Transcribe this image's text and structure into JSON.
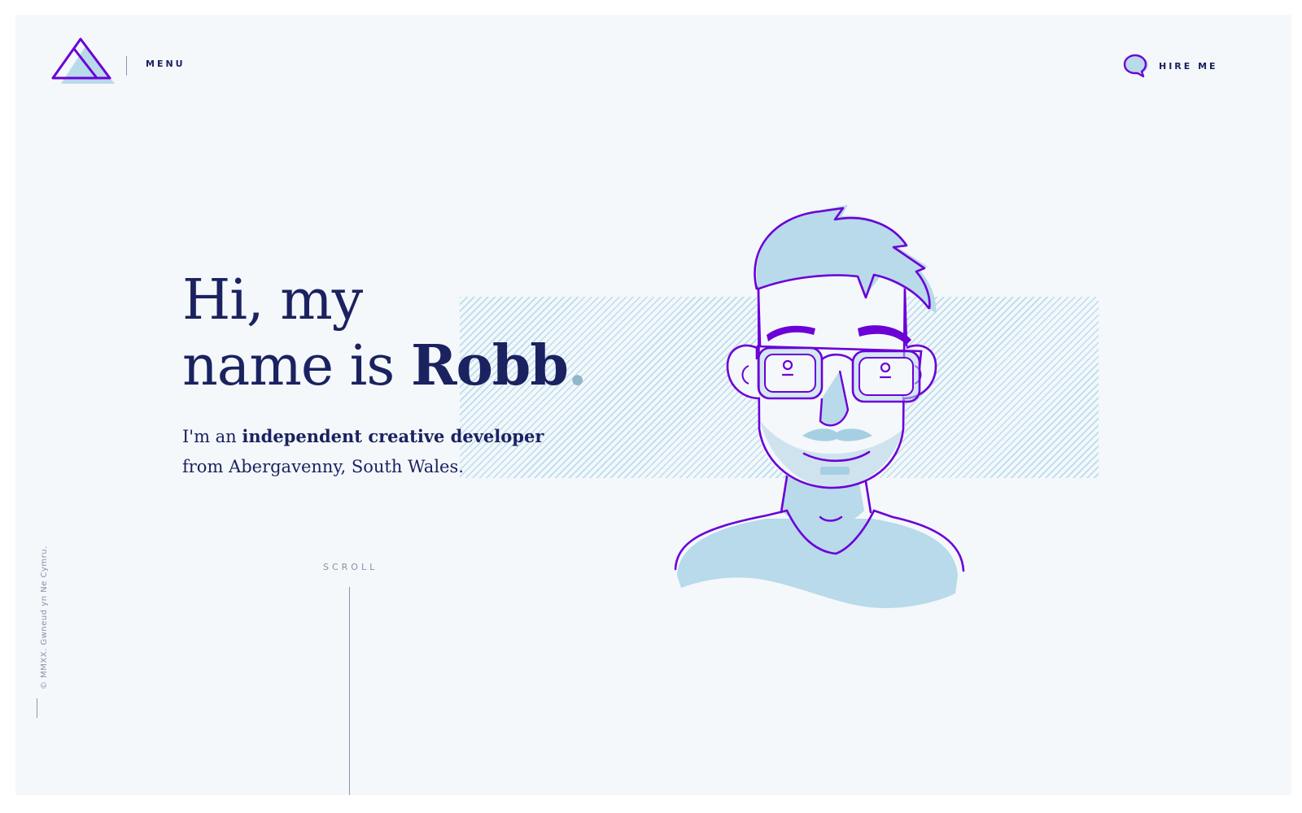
{
  "header": {
    "menu_label": "MENU",
    "hire_label": "HIRE ME"
  },
  "hero": {
    "headline_line1": "Hi, my",
    "headline_line2_prefix": "name is ",
    "headline_name": "Robb",
    "headline_dot": ".",
    "intro_prefix": "I'm an ",
    "intro_bold": "independent creative developer",
    "intro_line2": "from Abergavenny, South Wales."
  },
  "scroll": {
    "label": "SCROLL"
  },
  "footer": {
    "copyright": "© MMXX. Gwneud yn Ne Cymru."
  },
  "colors": {
    "navy": "#1b2260",
    "purple": "#6b00d7",
    "light_blue": "#b8daea",
    "background": "#f4f8fb"
  },
  "icons": {
    "logo": "triangle-logo-icon",
    "hire": "speech-bubble-icon",
    "portrait": "robb-portrait-illustration"
  }
}
